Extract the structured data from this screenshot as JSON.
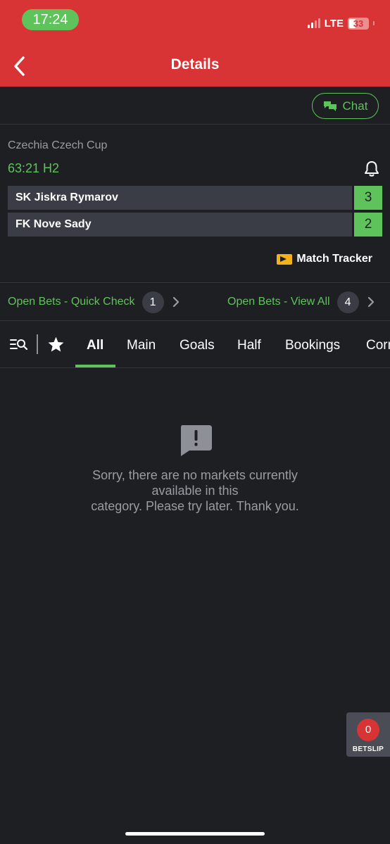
{
  "status_bar": {
    "time": "17:24",
    "network": "LTE",
    "battery": "33"
  },
  "header": {
    "title": "Details"
  },
  "chat": {
    "label": "Chat"
  },
  "match": {
    "competition": "Czechia Czech Cup",
    "clock": "63:21 H2",
    "teams": [
      {
        "name": "SK Jiskra Rymarov",
        "score": "3"
      },
      {
        "name": "FK Nove Sady",
        "score": "2"
      }
    ],
    "tracker_label": "Match Tracker"
  },
  "open_bets": {
    "quick_check": {
      "label": "Open Bets - Quick Check",
      "count": "1"
    },
    "view_all": {
      "label": "Open Bets - View All",
      "count": "4"
    }
  },
  "tabs": [
    "All",
    "Main",
    "Goals",
    "Half",
    "Bookings",
    "Corners"
  ],
  "empty_state": {
    "line1": "Sorry, there are no markets currently",
    "line2": "available in this",
    "line3": "category. Please try later. Thank you."
  },
  "betslip": {
    "count": "0",
    "label": "BETSLIP"
  },
  "colors": {
    "brand_red": "#d93435",
    "accent_green": "#5fc35b",
    "background": "#1e1f23"
  }
}
